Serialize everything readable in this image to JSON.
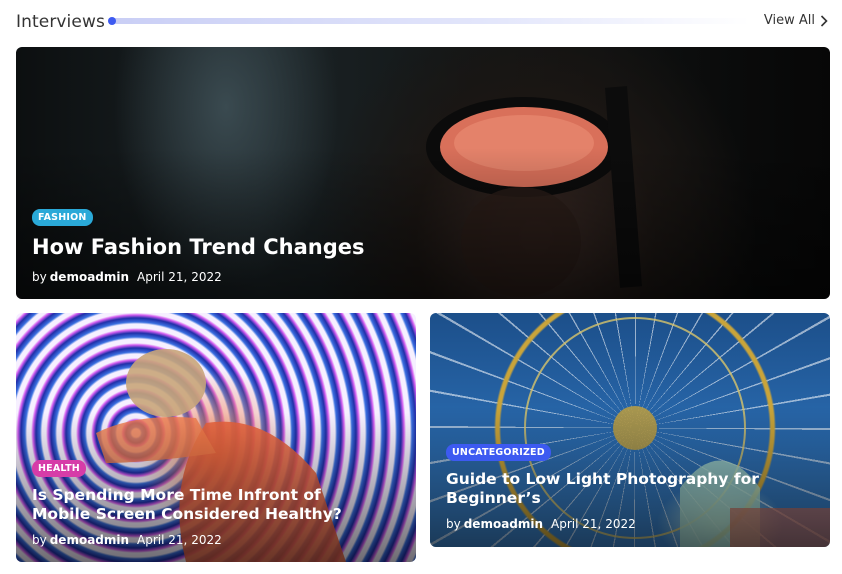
{
  "section": {
    "title": "Interviews",
    "view_all": "View All",
    "accent": "#3d5af1"
  },
  "cards": [
    {
      "category": "FASHION",
      "category_color": "#2aa9d8",
      "title": "How Fashion Trend Changes",
      "by": "by",
      "author": "demoadmin",
      "date": "April 21, 2022"
    },
    {
      "category": "HEALTH",
      "category_color": "#d63ca8",
      "title": "Is Spending More Time Infront of Mobile Screen Considered Healthy?",
      "by": "by",
      "author": "demoadmin",
      "date": "April 21, 2022"
    },
    {
      "category": "UNCATEGORIZED",
      "category_color": "#3d5af1",
      "title": "Guide to Low Light Photography for Beginner’s",
      "by": "by",
      "author": "demoadmin",
      "date": "April 21, 2022"
    }
  ]
}
